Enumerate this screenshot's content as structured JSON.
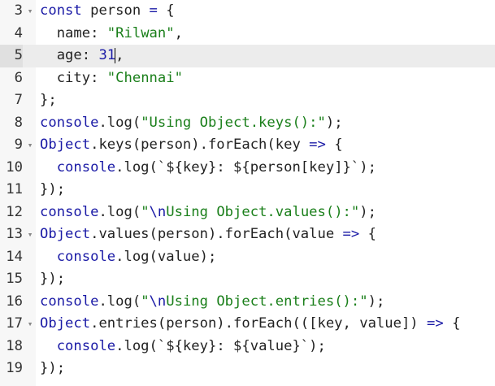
{
  "editor": {
    "lines": [
      {
        "num": "3",
        "fold": true,
        "active": false,
        "tokens": [
          {
            "t": "const",
            "c": "kw"
          },
          {
            "t": " person ",
            "c": ""
          },
          {
            "t": "=",
            "c": "op"
          },
          {
            "t": " {",
            "c": ""
          }
        ]
      },
      {
        "num": "4",
        "fold": false,
        "active": false,
        "tokens": [
          {
            "t": "  name: ",
            "c": ""
          },
          {
            "t": "\"Rilwan\"",
            "c": "str"
          },
          {
            "t": ",",
            "c": ""
          }
        ]
      },
      {
        "num": "5",
        "fold": false,
        "active": true,
        "tokens": [
          {
            "t": "  age: ",
            "c": ""
          },
          {
            "t": "31",
            "c": "num-lit"
          },
          {
            "t": "|",
            "c": "cursor"
          },
          {
            "t": ",",
            "c": ""
          }
        ]
      },
      {
        "num": "6",
        "fold": false,
        "active": false,
        "tokens": [
          {
            "t": "  city: ",
            "c": ""
          },
          {
            "t": "\"Chennai\"",
            "c": "str"
          }
        ]
      },
      {
        "num": "7",
        "fold": false,
        "active": false,
        "tokens": [
          {
            "t": "};",
            "c": ""
          }
        ]
      },
      {
        "num": "8",
        "fold": false,
        "active": false,
        "tokens": [
          {
            "t": "console",
            "c": "obj"
          },
          {
            "t": ".log(",
            "c": ""
          },
          {
            "t": "\"Using Object.keys():\"",
            "c": "str"
          },
          {
            "t": ");",
            "c": ""
          }
        ]
      },
      {
        "num": "9",
        "fold": true,
        "active": false,
        "tokens": [
          {
            "t": "Object",
            "c": "obj"
          },
          {
            "t": ".keys(person).forEach(key ",
            "c": ""
          },
          {
            "t": "=>",
            "c": "op"
          },
          {
            "t": " {",
            "c": ""
          }
        ]
      },
      {
        "num": "10",
        "fold": false,
        "active": false,
        "tokens": [
          {
            "t": "  ",
            "c": ""
          },
          {
            "t": "console",
            "c": "obj"
          },
          {
            "t": ".log(",
            "c": ""
          },
          {
            "t": "`${key}: ${person[key]}`",
            "c": ""
          },
          {
            "t": ");",
            "c": ""
          }
        ]
      },
      {
        "num": "11",
        "fold": false,
        "active": false,
        "tokens": [
          {
            "t": "});",
            "c": ""
          }
        ]
      },
      {
        "num": "12",
        "fold": false,
        "active": false,
        "tokens": [
          {
            "t": "console",
            "c": "obj"
          },
          {
            "t": ".log(",
            "c": ""
          },
          {
            "t": "\"",
            "c": "str"
          },
          {
            "t": "\\n",
            "c": "esc"
          },
          {
            "t": "Using Object.values():\"",
            "c": "str"
          },
          {
            "t": ");",
            "c": ""
          }
        ]
      },
      {
        "num": "13",
        "fold": true,
        "active": false,
        "tokens": [
          {
            "t": "Object",
            "c": "obj"
          },
          {
            "t": ".values(person).forEach(value ",
            "c": ""
          },
          {
            "t": "=>",
            "c": "op"
          },
          {
            "t": " {",
            "c": ""
          }
        ]
      },
      {
        "num": "14",
        "fold": false,
        "active": false,
        "tokens": [
          {
            "t": "  ",
            "c": ""
          },
          {
            "t": "console",
            "c": "obj"
          },
          {
            "t": ".log(value);",
            "c": ""
          }
        ]
      },
      {
        "num": "15",
        "fold": false,
        "active": false,
        "tokens": [
          {
            "t": "});",
            "c": ""
          }
        ]
      },
      {
        "num": "16",
        "fold": false,
        "active": false,
        "tokens": [
          {
            "t": "console",
            "c": "obj"
          },
          {
            "t": ".log(",
            "c": ""
          },
          {
            "t": "\"",
            "c": "str"
          },
          {
            "t": "\\n",
            "c": "esc"
          },
          {
            "t": "Using Object.entries():\"",
            "c": "str"
          },
          {
            "t": ");",
            "c": ""
          }
        ]
      },
      {
        "num": "17",
        "fold": true,
        "active": false,
        "tokens": [
          {
            "t": "Object",
            "c": "obj"
          },
          {
            "t": ".entries(person).forEach(([key, value]) ",
            "c": ""
          },
          {
            "t": "=>",
            "c": "op"
          },
          {
            "t": " {",
            "c": ""
          }
        ]
      },
      {
        "num": "18",
        "fold": false,
        "active": false,
        "tokens": [
          {
            "t": "  ",
            "c": ""
          },
          {
            "t": "console",
            "c": "obj"
          },
          {
            "t": ".log(",
            "c": ""
          },
          {
            "t": "`${key}: ${value}`",
            "c": ""
          },
          {
            "t": ");",
            "c": ""
          }
        ]
      },
      {
        "num": "19",
        "fold": false,
        "active": false,
        "tokens": [
          {
            "t": "});",
            "c": ""
          }
        ]
      }
    ],
    "fold_icon": "chevron-down-icon",
    "colors": {
      "keyword": "#1a1aa6",
      "string": "#1a7f1a",
      "active_line": "#ececec",
      "gutter": "#f7f7f7"
    }
  }
}
